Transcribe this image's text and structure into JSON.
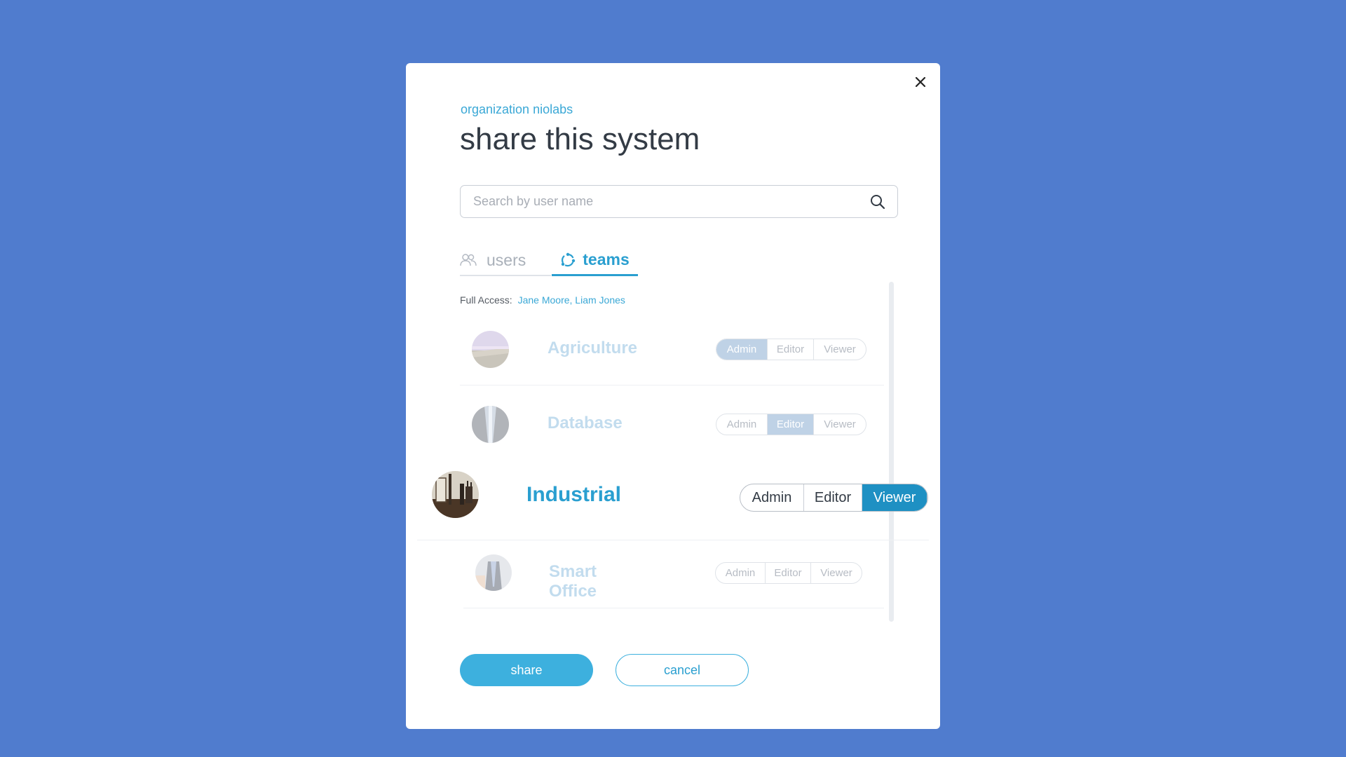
{
  "dialog": {
    "eyebrow": "organization niolabs",
    "title": "share this system",
    "close_icon": "close-icon"
  },
  "search": {
    "placeholder": "Search by user name",
    "value": "",
    "icon": "search-icon"
  },
  "tabs": [
    {
      "label": "users",
      "icon": "users-icon",
      "active": false
    },
    {
      "label": "teams",
      "icon": "teams-icon",
      "active": true
    }
  ],
  "full_access": {
    "label": "Full Access:",
    "names": "Jane Moore, Liam Jones"
  },
  "roles": [
    "Admin",
    "Editor",
    "Viewer"
  ],
  "teams": [
    {
      "name": "Agriculture",
      "role": "Admin",
      "avatar": "agriculture-avatar"
    },
    {
      "name": "Database",
      "role": "Editor",
      "avatar": "database-avatar"
    },
    {
      "name": "Industrial",
      "role": "Viewer",
      "avatar": "industrial-avatar",
      "focused": true
    },
    {
      "name": "Smart Office",
      "role": "",
      "avatar": "smart-office-avatar"
    }
  ],
  "actions": {
    "share_label": "share",
    "cancel_label": "cancel"
  },
  "colors": {
    "background": "#507cce",
    "accent": "#2a9fd0",
    "primary_button": "#3db0de",
    "active_role": "#1e90c3",
    "faded_active_role": "#bfd2e6"
  }
}
